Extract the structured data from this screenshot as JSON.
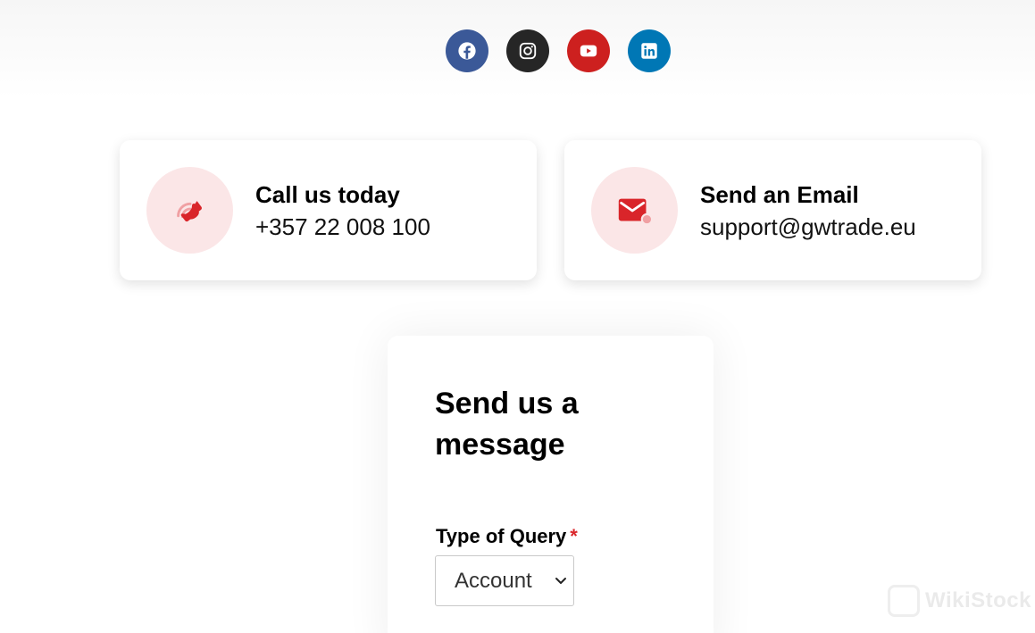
{
  "social": {
    "items": [
      {
        "network": "facebook",
        "icon": "facebook-icon",
        "color": "#3b5998"
      },
      {
        "network": "instagram",
        "icon": "instagram-icon",
        "color": "#262626"
      },
      {
        "network": "youtube",
        "icon": "youtube-icon",
        "color": "#cd201f"
      },
      {
        "network": "linkedin",
        "icon": "linkedin-icon",
        "color": "#0077b5"
      }
    ]
  },
  "contact": {
    "call": {
      "title": "Call us today",
      "value": "+357 22 008 100",
      "icon": "phone-icon"
    },
    "email": {
      "title": "Send an Email",
      "value": "support@gwtrade.eu",
      "icon": "envelope-icon"
    },
    "accent_color": "#d9252a",
    "icon_bg_color": "#fbe6e7"
  },
  "form": {
    "title": "Send us a message",
    "query_type": {
      "label": "Type of Query",
      "required_mark": "*",
      "selected": "Account"
    }
  },
  "watermark": {
    "text": "WikiStock"
  }
}
